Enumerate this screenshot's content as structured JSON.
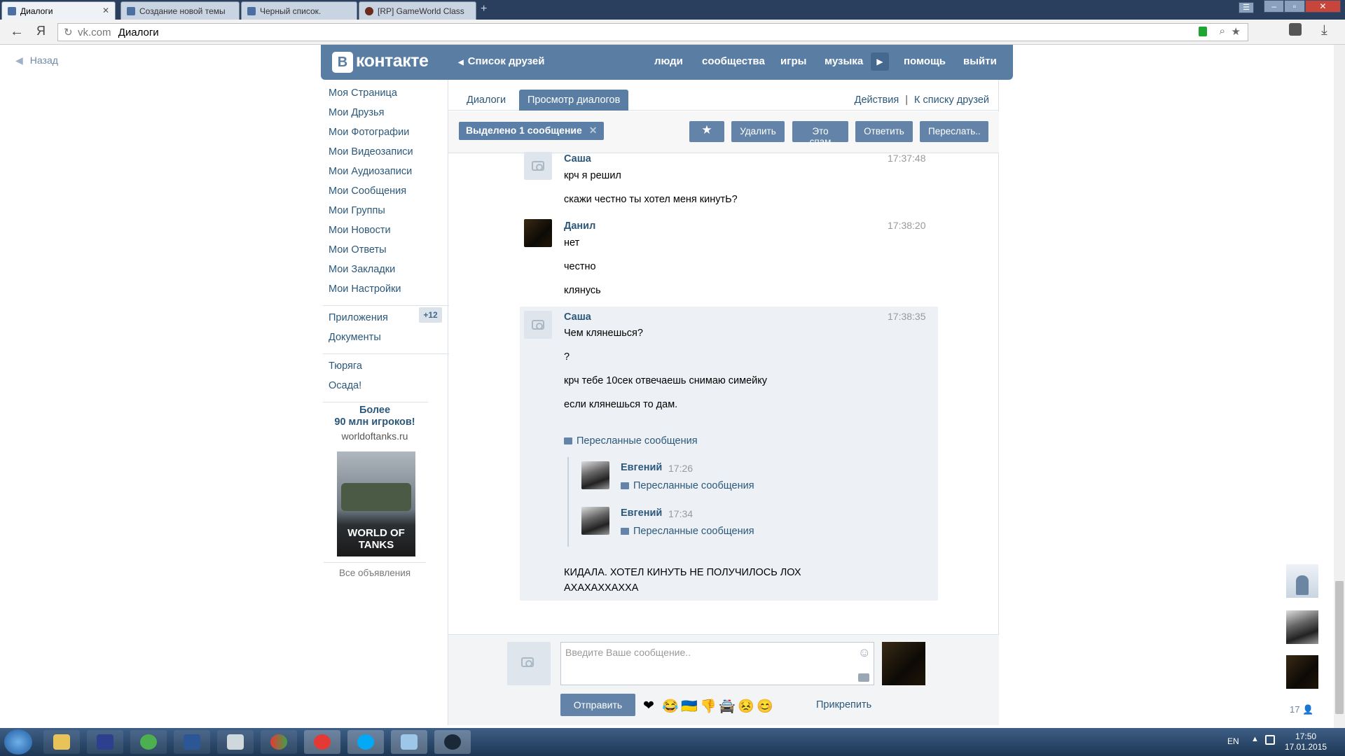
{
  "browser": {
    "tabs": [
      {
        "label": "Диалоги",
        "active": true
      },
      {
        "label": "Создание новой темы",
        "active": false
      },
      {
        "label": "Черный список.",
        "active": false
      },
      {
        "label": "[RP] GameWorld Class",
        "active": false
      }
    ],
    "url_domain": "vk.com",
    "url_title": "Диалоги"
  },
  "page": {
    "back_label": "Назад",
    "logo_letter": "В",
    "logo_text": "контакте",
    "header": {
      "friends_list": "Список друзей",
      "nav": [
        "люди",
        "сообщества",
        "игры",
        "музыка",
        "помощь",
        "выйти"
      ]
    },
    "menu": {
      "items": [
        "Моя Страница",
        "Мои Друзья",
        "Мои Фотографии",
        "Мои Видеозаписи",
        "Мои Аудиозаписи",
        "Мои Сообщения",
        "Мои Группы",
        "Мои Новости",
        "Мои Ответы",
        "Мои Закладки",
        "Мои Настройки"
      ],
      "apps_label": "Приложения",
      "apps_badge": "+12",
      "docs_label": "Документы",
      "games": [
        "Тюряга",
        "Осада!"
      ]
    },
    "ad": {
      "title_line1": "Более",
      "title_line2": "90 млн игроков!",
      "site": "worldoftanks.ru",
      "image_text": "WORLD OF TANKS",
      "all_ads": "Все объявления"
    },
    "tabs": {
      "dialogs": "Диалоги",
      "view_dialogs": "Просмотр диалогов",
      "actions": "Действия",
      "divider": "|",
      "to_friends": "К списку друзей"
    },
    "toolbar": {
      "selected": "Выделено 1 сообщение",
      "star_icon": "★",
      "delete": "Удалить",
      "spam": "Это спам",
      "reply": "Ответить",
      "forward": "Переслать.."
    },
    "messages": [
      {
        "author": "Саша",
        "time": "17:37:48",
        "lines": [
          "крч я решил",
          "скажи честно ты хотел меня кинутЬ?"
        ]
      },
      {
        "author": "Данил",
        "time": "17:38:20",
        "lines": [
          "нет",
          "честно",
          "клянусь"
        ]
      },
      {
        "author": "Саша",
        "time": "17:38:35",
        "lines": [
          "Чем клянешься?",
          "?",
          "крч тебе 10сек отвечаешь снимаю симейку",
          "если клянешься то дам."
        ]
      }
    ],
    "forwarded": {
      "header": "Пересланные сообщения",
      "items": [
        {
          "author": "Евгений",
          "time": "17:26",
          "label": "Пересланные сообщения"
        },
        {
          "author": "Евгений",
          "time": "17:34",
          "label": "Пересланные сообщения"
        }
      ],
      "final_text_line1": "КИДАЛА. ХОТЕЛ КИНУТЬ НЕ ПОЛУЧИЛОСЬ ЛОХ",
      "final_text_line2": "АХАХАХХАХХА"
    },
    "composer": {
      "placeholder": "Введите Ваше сообщение..",
      "send": "Отправить",
      "emojis": [
        "❤",
        "😂",
        "🇺🇦",
        "👎",
        "🚔",
        "😣",
        "😊"
      ],
      "attach": "Прикрепить"
    },
    "online_count": "17"
  },
  "taskbar": {
    "lang": "EN",
    "time": "17:50",
    "date": "17.01.2015"
  }
}
